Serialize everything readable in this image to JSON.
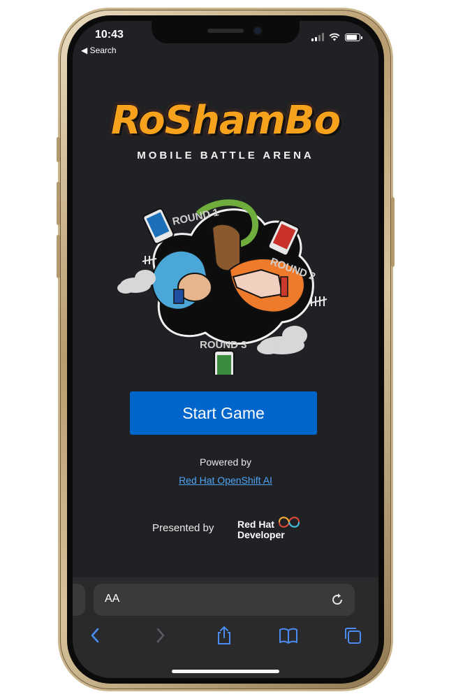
{
  "status_bar": {
    "time": "10:43",
    "back_label": "◀ Search"
  },
  "logo": {
    "title": "RoShamBo",
    "subtitle": "MOBILE BATTLE ARENA"
  },
  "artwork": {
    "round_labels": [
      "ROUND 1",
      "ROUND 2",
      "ROUND 3"
    ]
  },
  "main": {
    "start_button_label": "Start Game",
    "powered_by_label": "Powered by",
    "powered_by_link": "Red Hat OpenShift AI",
    "presented_by_label": "Presented by",
    "presenter_logo": {
      "line1": "Red Hat",
      "line2": "Developer"
    }
  },
  "browser": {
    "text_size_label": "AA"
  },
  "colors": {
    "background": "#202124",
    "primary_button": "#0066cc",
    "link": "#4ea4f5",
    "logo_orange": "#f7a21c"
  }
}
